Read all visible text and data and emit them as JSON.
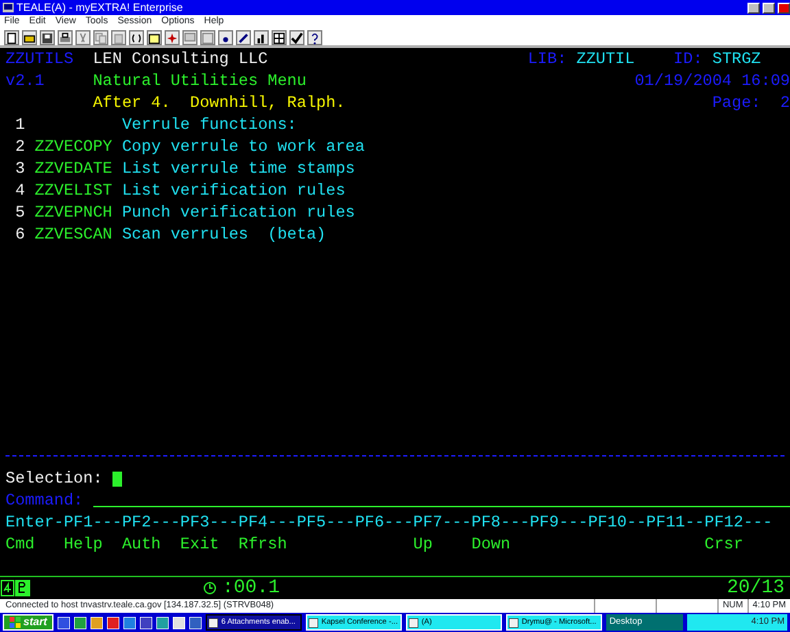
{
  "window": {
    "title": "TEALE(A) - myEXTRA! Enterprise"
  },
  "menu": [
    "File",
    "Edit",
    "View",
    "Tools",
    "Session",
    "Options",
    "Help"
  ],
  "header": {
    "program": "ZZUTILS",
    "company": "LEN Consulting LLC",
    "lib_label": "LIB:",
    "lib": "ZZUTIL",
    "id_label": "ID:",
    "id": "STRGZ",
    "version": "v2.1",
    "title": "Natural Utilities Menu",
    "datetime": "01/19/2004 16:09",
    "subtitle": "After 4.  Downhill, Ralph.",
    "page_label": "Page:",
    "page": "2"
  },
  "items": [
    {
      "number": "1",
      "description": "Verrule functions:"
    },
    {
      "number": "2",
      "code": "ZZVECOPY",
      "description": "Copy verrule to work area"
    },
    {
      "number": "3",
      "code": "ZZVEDATE",
      "description": "List verrule time stamps"
    },
    {
      "number": "4",
      "code": "ZZVELIST",
      "description": "List verification rules"
    },
    {
      "number": "5",
      "code": "ZZVEPNCH",
      "description": "Punch verification rules"
    },
    {
      "number": "6",
      "code": "ZZVESCAN",
      "description": "Scan verrules  (beta)"
    }
  ],
  "selection": {
    "label": "Selection:"
  },
  "command": {
    "label": "Command:"
  },
  "function_keys": [
    {
      "key": "Enter-",
      "label": "Cmd"
    },
    {
      "key": "PF1---",
      "label": "Help"
    },
    {
      "key": "PF2---",
      "label": "Auth"
    },
    {
      "key": "PF3---",
      "label": "Exit"
    },
    {
      "key": "PF4---",
      "label": "Rfrsh"
    },
    {
      "key": "PF5---"
    },
    {
      "key": "PF6---"
    },
    {
      "key": "PF7---",
      "label": "Up"
    },
    {
      "key": "PF8---",
      "label": "Down"
    },
    {
      "key": "PF9---"
    },
    {
      "key": "PF10--"
    },
    {
      "key": "PF11--"
    },
    {
      "key": "PF12---",
      "label": "Crsr"
    }
  ],
  "oia": {
    "timer": ":00.1",
    "cursor": "20/13"
  },
  "status_bar": {
    "connection": "Connected to host tnvastrv.teale.ca.gov [134.187.32.5] (STRVB048)",
    "num": "NUM",
    "time": "4:10 PM"
  },
  "taskbar": {
    "start": "start",
    "tasks": [
      {
        "label": "6 Attachments enab...",
        "selected": true
      },
      {
        "label": "Kapsel Conference -...",
        "selected": false
      },
      {
        "label": "(A)",
        "selected": false
      },
      {
        "label": "Drymu@ - Microsoft...",
        "selected": false
      }
    ],
    "tray": "Desktop",
    "clock": "4:10 PM"
  }
}
